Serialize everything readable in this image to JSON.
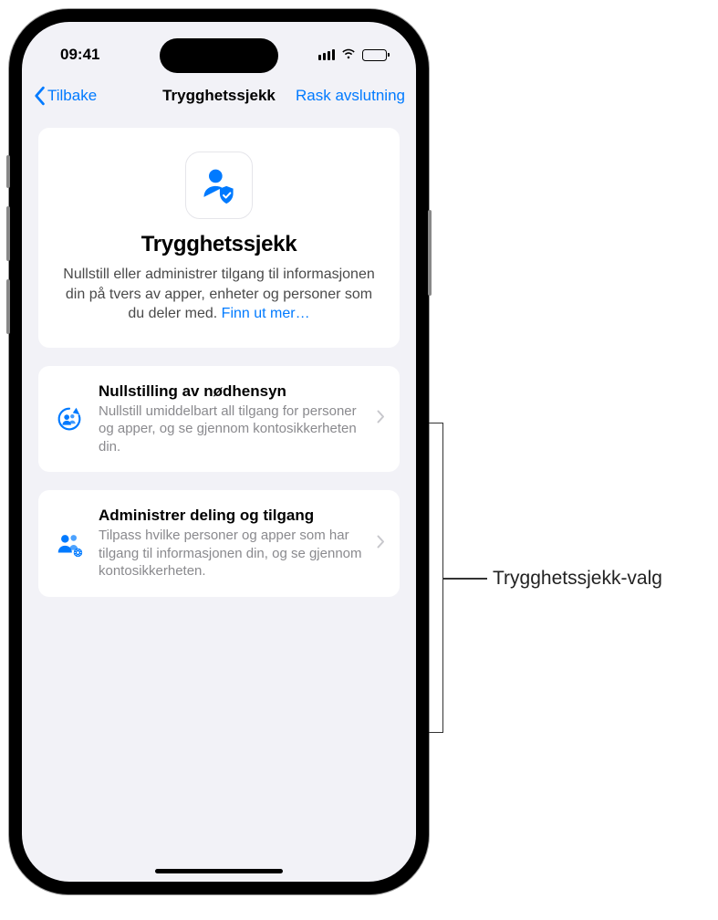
{
  "status": {
    "time": "09:41"
  },
  "nav": {
    "back": "Tilbake",
    "title": "Trygghetssjekk",
    "action": "Rask avslutning"
  },
  "hero": {
    "title": "Trygghetssjekk",
    "description": "Nullstill eller administrer tilgang til informasjonen din på tvers av apper, enheter og personer som du deler med. ",
    "link": "Finn ut mer…"
  },
  "options": [
    {
      "title": "Nullstilling av nødhensyn",
      "description": "Nullstill umiddelbart all tilgang for personer og apper, og se gjennom kontosikkerheten din."
    },
    {
      "title": "Administrer deling og tilgang",
      "description": "Tilpass hvilke personer og apper som har tilgang til informasjonen din, og se gjennom kontosikkerheten."
    }
  ],
  "callout": "Trygghetssjekk-valg",
  "colors": {
    "accent": "#007aff",
    "secondaryText": "#8a8a8e"
  }
}
